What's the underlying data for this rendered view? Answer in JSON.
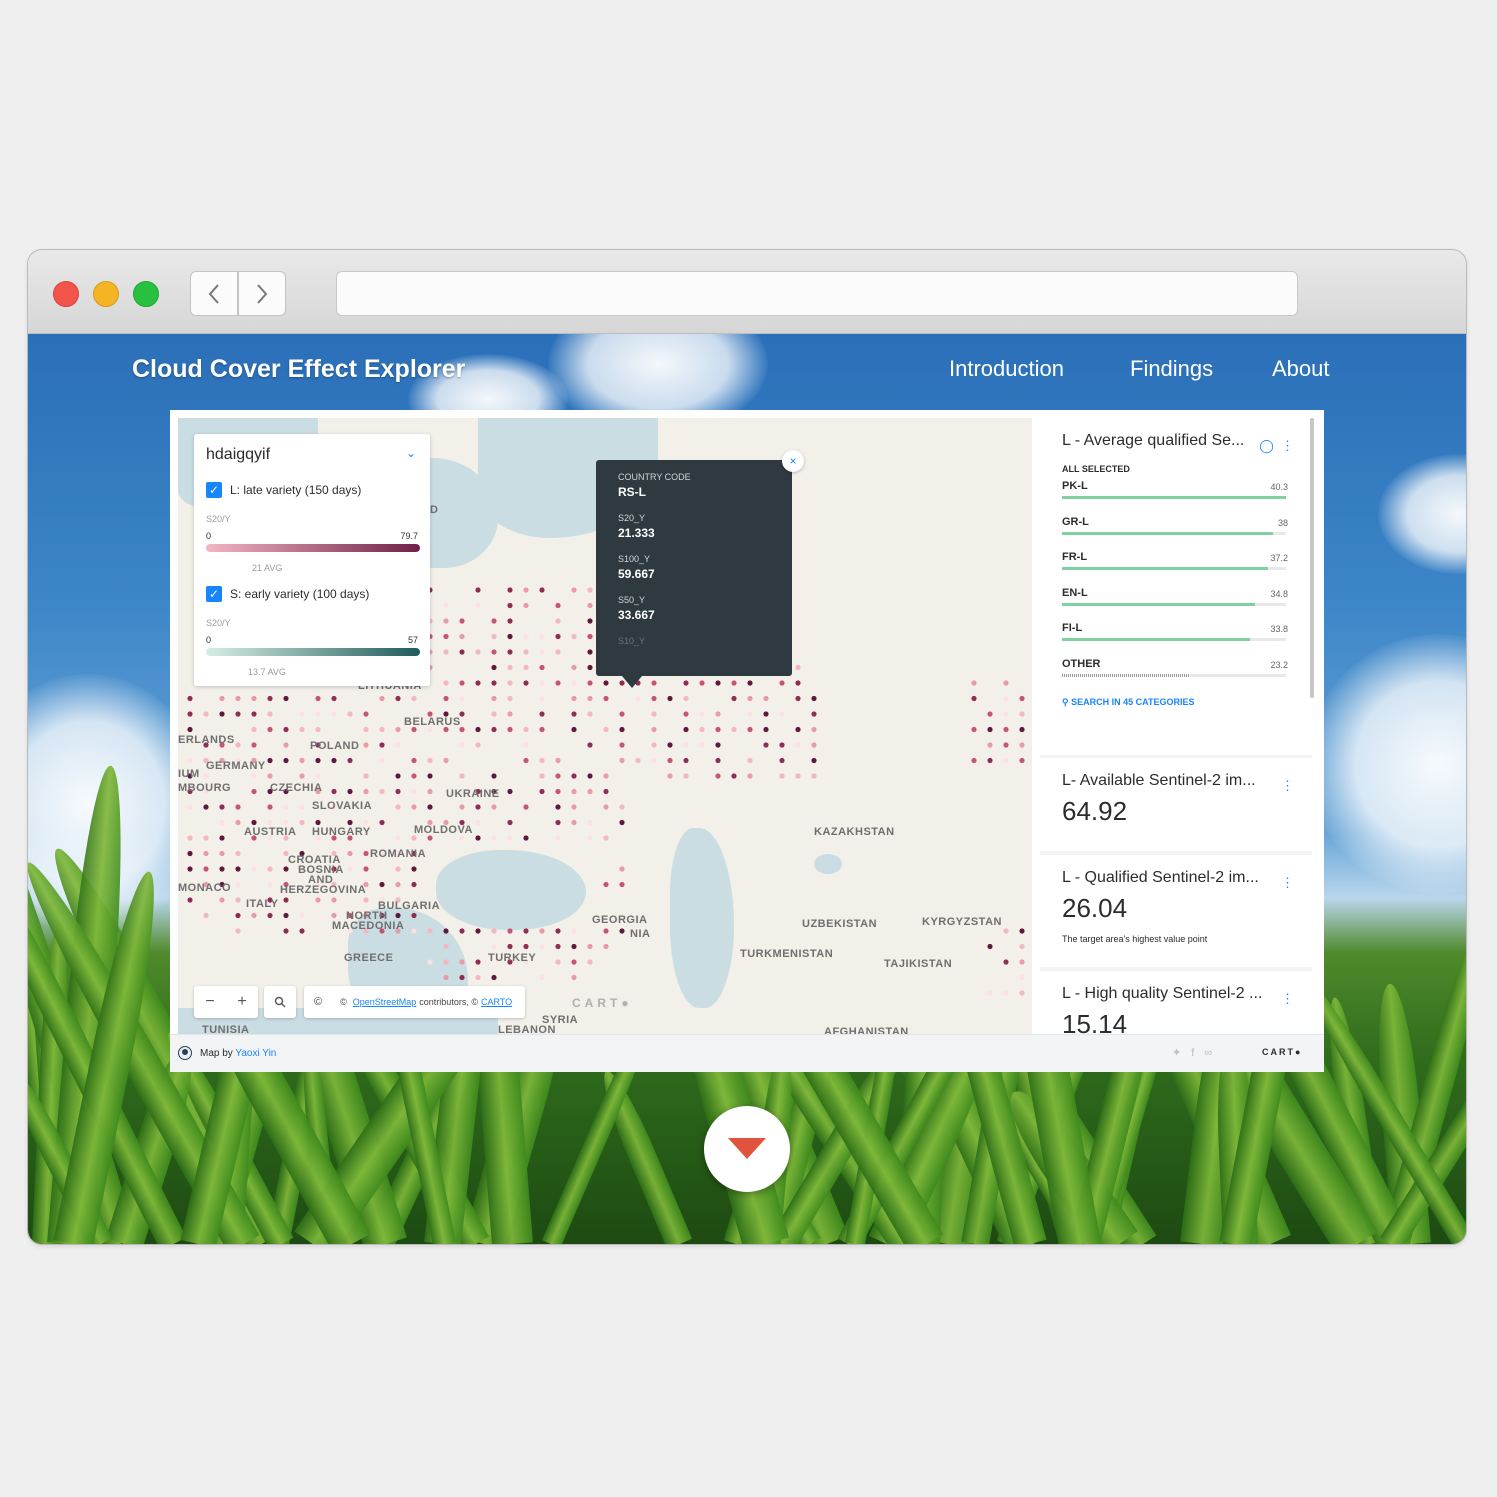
{
  "browser": {
    "back_icon": "chevron-left-icon",
    "forward_icon": "chevron-right-icon",
    "url": ""
  },
  "site": {
    "title": "Cloud Cover Effect Explorer",
    "nav": [
      "Introduction",
      "Findings",
      "About"
    ]
  },
  "legend": {
    "dataset": "hdaigqyif",
    "layers": [
      {
        "label": "L: late variety (150 days)",
        "field": "S20/Y",
        "min": "0",
        "max": "79.7",
        "avg": "21 AVG",
        "color_from": "#f3b6c3",
        "color_to": "#6e1f47"
      },
      {
        "label": "S: early variety (100 days)",
        "field": "S20/Y",
        "min": "0",
        "max": "57",
        "avg": "13.7 AVG",
        "color_from": "#d7efe6",
        "color_to": "#1e5a5a"
      }
    ]
  },
  "tooltip": {
    "fields": [
      {
        "label": "COUNTRY CODE",
        "value": "RS-L"
      },
      {
        "label": "S20_Y",
        "value": "21.333"
      },
      {
        "label": "S100_Y",
        "value": "59.667"
      },
      {
        "label": "S50_Y",
        "value": "33.667"
      }
    ],
    "faded": "S10_Y",
    "close_icon": "close-icon"
  },
  "map": {
    "labels": [
      "ERLANDS",
      "POLAND",
      "BELARUS",
      "IUM",
      "GERMANY",
      "MBOURG",
      "CZECHIA",
      "UKRAINE",
      "SLOVAKIA",
      "AUSTRIA",
      "HUNGARY",
      "MOLDOVA",
      "ROMANIA",
      "CROATIA",
      "BOSNIA",
      "AND",
      "HERZEGOVINA",
      "MONACO",
      "ITALY",
      "BULGARIA",
      "NORTH",
      "MACEDONIA",
      "GREECE",
      "TURKEY",
      "GEORGIA",
      "NIA",
      "KAZAKHSTAN",
      "UZBEKISTAN",
      "KYRGYZSTAN",
      "TURKMENISTAN",
      "TAJIKISTAN",
      "TUNISIA",
      "SYRIA",
      "LEBANON",
      "AFGHANISTAN",
      "LITHUANIA",
      "D"
    ],
    "controls": {
      "zoom_out": "−",
      "zoom_in": "+",
      "search": "search-icon",
      "attribution_icon": "©"
    },
    "attribution": {
      "prefix": "©",
      "osm": "OpenStreetMap",
      "mid": "contributors, ©",
      "carto": "CARTO"
    },
    "watermark": "CART●"
  },
  "widgets": {
    "category": {
      "title": "L - Average qualified Se...",
      "all_selected": "ALL SELECTED",
      "items": [
        {
          "name": "PK-L",
          "value": "40.3",
          "fraction": 1.0
        },
        {
          "name": "GR-L",
          "value": "38",
          "fraction": 0.94
        },
        {
          "name": "FR-L",
          "value": "37.2",
          "fraction": 0.92
        },
        {
          "name": "EN-L",
          "value": "34.8",
          "fraction": 0.86
        },
        {
          "name": "FI-L",
          "value": "33.8",
          "fraction": 0.84
        },
        {
          "name": "OTHER",
          "value": "23.2",
          "fraction": 0.57
        }
      ],
      "search": "SEARCH IN 45 CATEGORIES"
    },
    "formula": [
      {
        "title": "L- Available Sentinel-2 im...",
        "value": "64.92",
        "note": ""
      },
      {
        "title": "L - Qualified Sentinel-2 im...",
        "value": "26.04",
        "note": "The target area's highest value point"
      },
      {
        "title": "L - High quality Sentinel-2 ...",
        "value": "15.14",
        "note": ""
      }
    ]
  },
  "footer": {
    "map_by": "Map by",
    "author": "Yaoxi Yin",
    "social_icons": [
      "twitter-icon",
      "facebook-icon",
      "link-icon"
    ],
    "logo": "CART●"
  },
  "colors": {
    "accent": "#1785fb",
    "dot_light": "#f3b6c3",
    "dot_dark": "#5e1a3c",
    "scroll_arrow": "#e0533d"
  }
}
